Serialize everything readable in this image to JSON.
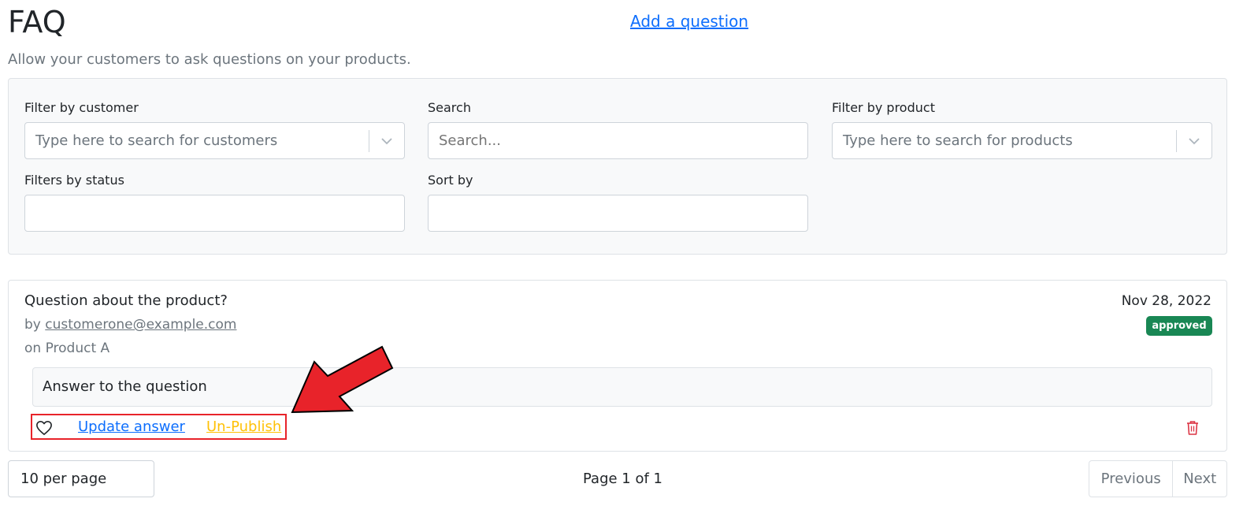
{
  "header": {
    "title": "FAQ",
    "add_question_label": "Add a question",
    "subtitle": "Allow your customers to ask questions on your products."
  },
  "filters": {
    "customer": {
      "label": "Filter by customer",
      "placeholder": "Type here to search for customers"
    },
    "search": {
      "label": "Search",
      "placeholder": "Search..."
    },
    "product": {
      "label": "Filter by product",
      "placeholder": "Type here to search for products"
    },
    "status": {
      "label": "Filters by status",
      "value": ""
    },
    "sort": {
      "label": "Sort by",
      "value": ""
    }
  },
  "questions": [
    {
      "title": "Question about the product?",
      "by_prefix": "by",
      "author": "customerone@example.com",
      "product": "on Product A",
      "date": "Nov 28, 2022",
      "status": "approved",
      "answer": "Answer to the question",
      "actions": {
        "update_label": "Update answer",
        "unpublish_label": "Un-Publish"
      },
      "icons": {
        "like": "heart-outline-icon",
        "delete": "trash-icon"
      }
    }
  ],
  "pagination": {
    "per_page": "10 per page",
    "page_info": "Page 1 of 1",
    "previous_label": "Previous",
    "next_label": "Next"
  },
  "colors": {
    "link": "#0d6efd",
    "warning": "#ffc107",
    "success": "#198754",
    "danger": "#dc3545",
    "annotation": "#e8232a"
  }
}
